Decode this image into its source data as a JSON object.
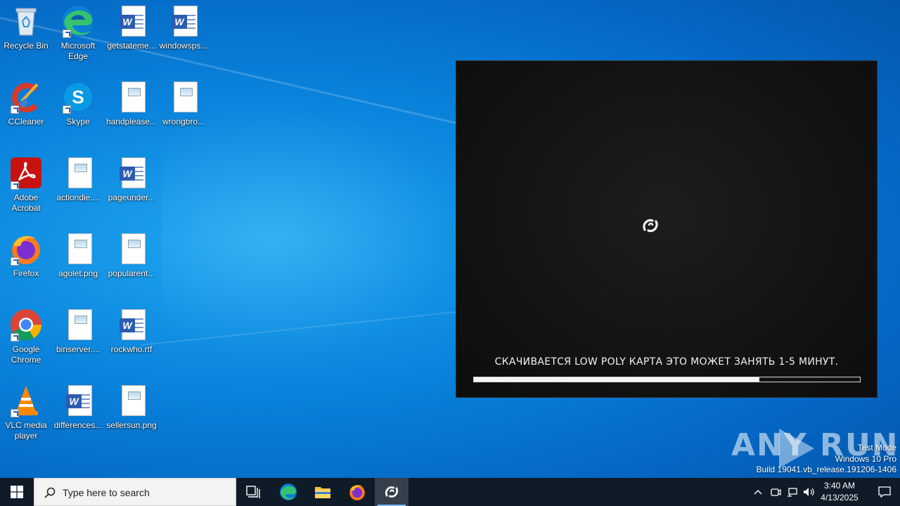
{
  "desktop": {
    "icons": [
      {
        "label": "Recycle Bin"
      },
      {
        "label": "Microsoft Edge"
      },
      {
        "label": "getstateme..."
      },
      {
        "label": "windowsps..."
      },
      {
        "label": "CCleaner"
      },
      {
        "label": "Skype"
      },
      {
        "label": "handplease..."
      },
      {
        "label": "wrongbro..."
      },
      {
        "label": "Adobe Acrobat"
      },
      {
        "label": "actiondie...."
      },
      {
        "label": "pageunder..."
      },
      {
        "label": "Firefox"
      },
      {
        "label": "agolet.png"
      },
      {
        "label": "popularent..."
      },
      {
        "label": "Google Chrome"
      },
      {
        "label": "binserver...."
      },
      {
        "label": "rockwho.rtf"
      },
      {
        "label": "VLC media player"
      },
      {
        "label": "differences..."
      },
      {
        "label": "sellersun.png"
      }
    ]
  },
  "loader": {
    "message": "СКАЧИВАЕТСЯ LOW POLY КАРТА ЭТО МОЖЕТ ЗАНЯТЬ 1-5 МИНУТ.",
    "progress": 0.74
  },
  "watermark": {
    "brand": "ANY RUN",
    "test_mode": "Test Mode",
    "edition": "Windows 10 Pro",
    "build": "Build 19041.vb_release.191206-1406"
  },
  "taskbar": {
    "search_placeholder": "Type here to search",
    "time": "3:40 AM",
    "date": "4/13/2025"
  }
}
